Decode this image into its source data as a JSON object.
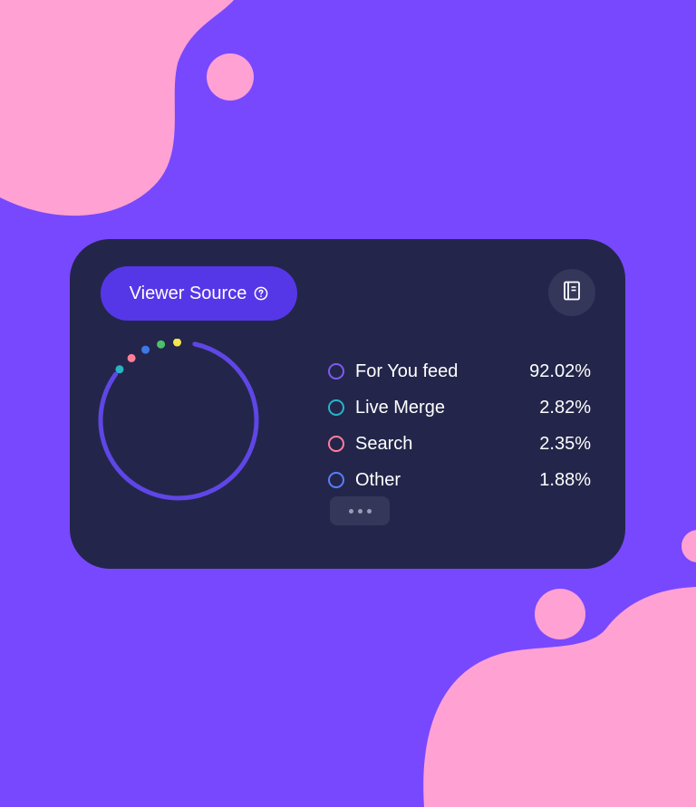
{
  "colors": {
    "background": "#7848ff",
    "blob": "#ffa1d3",
    "card": "#23264a",
    "button": "#5537e8",
    "ring": "#5f46e6"
  },
  "card": {
    "source_button": {
      "label": "Viewer Source",
      "icon": "help-circle-icon"
    },
    "doc_button": {
      "icon": "notebook-icon"
    },
    "more_button": {
      "icon": "ellipsis-icon"
    }
  },
  "legend": [
    {
      "label": "For You feed",
      "value": "92.02%",
      "color": "#7f5af0"
    },
    {
      "label": "Live Merge",
      "value": "2.82%",
      "color": "#2ab3c6"
    },
    {
      "label": "Search",
      "value": "2.35%",
      "color": "#ff7e9b"
    },
    {
      "label": "Other",
      "value": "1.88%",
      "color": "#5a7dff"
    }
  ],
  "chart_data": {
    "type": "pie",
    "categories": [
      "For You feed",
      "Live Merge",
      "Search",
      "Other"
    ],
    "values": [
      92.02,
      2.82,
      2.35,
      1.88
    ],
    "dot_colors": [
      "#f5e64f",
      "#4cc16c",
      "#3e78e6",
      "#ff7e9b",
      "#2ab3c6"
    ]
  }
}
